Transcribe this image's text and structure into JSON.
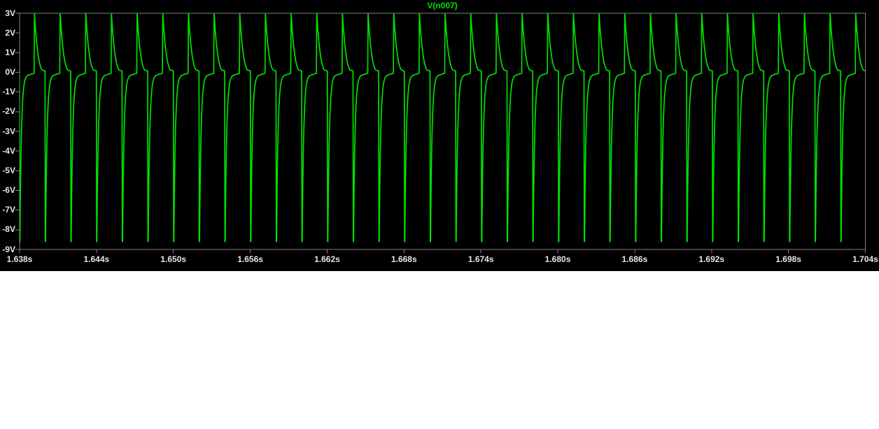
{
  "window": {
    "app_background": "#ffffff",
    "plot_background": "#000000",
    "frame_color": "#828282",
    "axis_text_color": "#e6e6e6"
  },
  "chart_data": {
    "type": "line",
    "title": "V(n007)",
    "title_color": "#00e000",
    "grid": false,
    "legend_position": "top-center-title",
    "series": [
      {
        "name": "V(n007)",
        "color": "#00e000"
      }
    ],
    "x_axis": {
      "unit": "s",
      "min_s": 1.638,
      "max_s": 1.704,
      "tick_step_s": 0.006,
      "tick_labels": [
        "1.638s",
        "1.644s",
        "1.650s",
        "1.656s",
        "1.662s",
        "1.668s",
        "1.674s",
        "1.680s",
        "1.686s",
        "1.692s",
        "1.698s",
        "1.704s"
      ]
    },
    "y_axis": {
      "unit": "V",
      "min_V": -9,
      "max_V": 3,
      "tick_step_V": 1,
      "tick_labels": [
        "3V",
        "2V",
        "1V",
        "0V",
        "-1V",
        "-2V",
        "-3V",
        "-4V",
        "-5V",
        "-6V",
        "-7V",
        "-8V",
        "-9V"
      ]
    },
    "waveform": {
      "description": "Periodic relaxation-oscillator spike train: fast rise to +3V, exponential decay to ~0.1V shelf, narrow drop to -8.6V, exponential recovery to ~-0.1V baseline",
      "period_ms": 2.0028,
      "first_rise_offset_ms": 1.13,
      "cycles_rendered": 34,
      "first_cycle_index": -1,
      "peak_V": 3.0,
      "trough_V": -8.6,
      "shelf_V": 0.08,
      "baseline_V": -0.08,
      "cycle_keypoints_ms_V": [
        [
          0.0,
          -0.05
        ],
        [
          0.03,
          3.0
        ],
        [
          0.07,
          2.58
        ],
        [
          0.11,
          2.21
        ],
        [
          0.15,
          1.88
        ],
        [
          0.19,
          1.58
        ],
        [
          0.24,
          1.27
        ],
        [
          0.29,
          1.0
        ],
        [
          0.34,
          0.77
        ],
        [
          0.4,
          0.55
        ],
        [
          0.46,
          0.38
        ],
        [
          0.52,
          0.25
        ],
        [
          0.58,
          0.16
        ],
        [
          0.64,
          0.11
        ],
        [
          0.72,
          0.09
        ],
        [
          0.8,
          0.08
        ],
        [
          0.855,
          0.07
        ],
        [
          0.875,
          -8.6
        ],
        [
          0.895,
          -8.6
        ],
        [
          0.92,
          -6.95
        ],
        [
          0.95,
          -5.38
        ],
        [
          0.99,
          -3.83
        ],
        [
          1.03,
          -2.74
        ],
        [
          1.08,
          -1.82
        ],
        [
          1.14,
          -1.13
        ],
        [
          1.21,
          -0.67
        ],
        [
          1.29,
          -0.39
        ],
        [
          1.38,
          -0.24
        ],
        [
          1.5,
          -0.16
        ],
        [
          1.65,
          -0.12
        ],
        [
          1.8,
          -0.09
        ],
        [
          1.95,
          -0.06
        ]
      ]
    }
  }
}
